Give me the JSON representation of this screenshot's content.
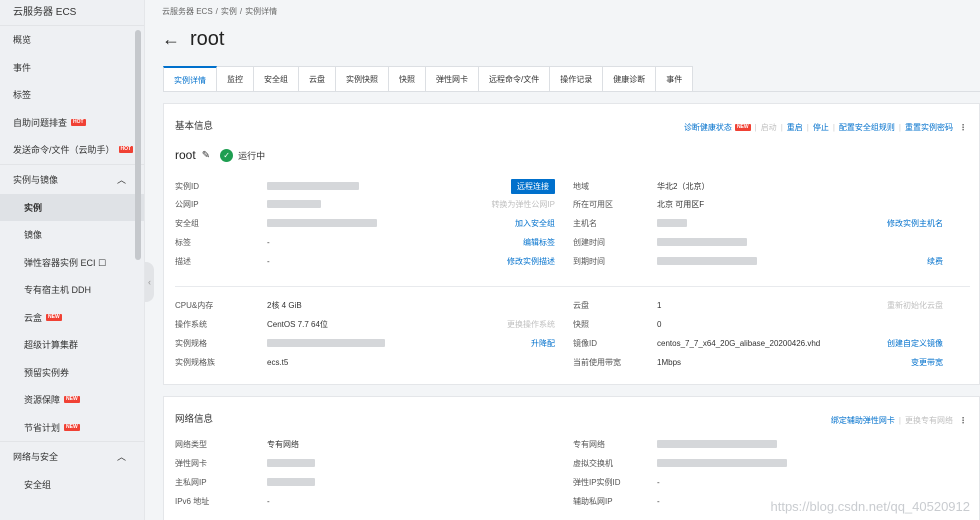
{
  "sidebar": {
    "title": "云服务器 ECS",
    "items_top": [
      {
        "label": "概览"
      },
      {
        "label": "事件"
      },
      {
        "label": "标签"
      },
      {
        "label": "自助问题排查",
        "badge": "HOT"
      },
      {
        "label": "发送命令/文件（云助手）",
        "badge": "HOT"
      }
    ],
    "group1": {
      "label": "实例与镜像",
      "chevron": "chevron-up-icon"
    },
    "group1_items": [
      {
        "label": "实例"
      },
      {
        "label": "镜像"
      },
      {
        "label": "弹性容器实例 ECI ☐"
      },
      {
        "label": "专有宿主机 DDH"
      },
      {
        "label": "云盒",
        "badge": "NEW"
      },
      {
        "label": "超级计算集群"
      },
      {
        "label": "预留实例券"
      },
      {
        "label": "资源保障",
        "badge": "NEW"
      },
      {
        "label": "节省计划",
        "badge": "NEW"
      }
    ],
    "group2": {
      "label": "网络与安全",
      "chevron": "chevron-up-icon"
    },
    "group2_items": [
      {
        "label": "安全组"
      }
    ]
  },
  "breadcrumb": [
    "云服务器 ECS",
    "/",
    "实例",
    "/",
    "实例详情"
  ],
  "title": "root",
  "tabs": [
    "实例详情",
    "监控",
    "安全组",
    "云盘",
    "实例快照",
    "快照",
    "弹性网卡",
    "远程命令/文件",
    "操作记录",
    "健康诊断",
    "事件"
  ],
  "basic": {
    "title": "基本信息",
    "actions": [
      "诊断健康状态",
      "启动",
      "重启",
      "停止",
      "配置安全组规则",
      "重置实例密码"
    ],
    "new_badge": "NEW",
    "instance_name": "root",
    "status": "运行中",
    "left_rows": [
      {
        "label": "实例ID",
        "value": "",
        "action": "远程连接"
      },
      {
        "label": "公网IP",
        "value": "",
        "action": "转换为弹性公网IP"
      },
      {
        "label": "安全组",
        "value": "",
        "action": "加入安全组"
      },
      {
        "label": "标签",
        "value": "-",
        "action": "编辑标签"
      },
      {
        "label": "描述",
        "value": "-",
        "action": "修改实例描述"
      }
    ],
    "right_rows": [
      {
        "label": "地域",
        "value": "华北2（北京）",
        "action": ""
      },
      {
        "label": "所在可用区",
        "value": "北京 可用区F",
        "action": ""
      },
      {
        "label": "主机名",
        "value": "",
        "action": "修改实例主机名"
      },
      {
        "label": "创建时间",
        "value": "",
        "action": ""
      },
      {
        "label": "到期时间",
        "value": "",
        "action": "续费"
      }
    ],
    "left_rows2": [
      {
        "label": "CPU&内存",
        "value": "2核 4 GiB",
        "action": ""
      },
      {
        "label": "操作系统",
        "value": "CentOS 7.7 64位",
        "action": "更换操作系统"
      },
      {
        "label": "实例规格",
        "value": "",
        "action": "升降配"
      },
      {
        "label": "实例规格族",
        "value": "ecs.t5",
        "action": ""
      }
    ],
    "right_rows2": [
      {
        "label": "云盘",
        "value": "1",
        "action": "重新初始化云盘"
      },
      {
        "label": "快照",
        "value": "0",
        "action": ""
      },
      {
        "label": "镜像ID",
        "value": "centos_7_7_x64_20G_alibase_20200426.vhd",
        "action": "创建自定义镜像"
      },
      {
        "label": "当前使用带宽",
        "value": "1Mbps",
        "action": "变更带宽"
      }
    ]
  },
  "network": {
    "title": "网络信息",
    "actions": [
      "绑定辅助弹性网卡",
      "更换专有网络"
    ],
    "left_rows": [
      {
        "label": "网络类型",
        "value": "专有网络"
      },
      {
        "label": "弹性网卡",
        "value": ""
      },
      {
        "label": "主私网IP",
        "value": ""
      },
      {
        "label": "IPv6 地址",
        "value": "-"
      }
    ],
    "right_rows": [
      {
        "label": "专有网络",
        "value": ""
      },
      {
        "label": "虚拟交换机",
        "value": ""
      },
      {
        "label": "弹性IP实例ID",
        "value": "-"
      },
      {
        "label": "辅助私网IP",
        "value": "-"
      }
    ]
  },
  "watermark": "https://blog.csdn.net/qq_40520912"
}
